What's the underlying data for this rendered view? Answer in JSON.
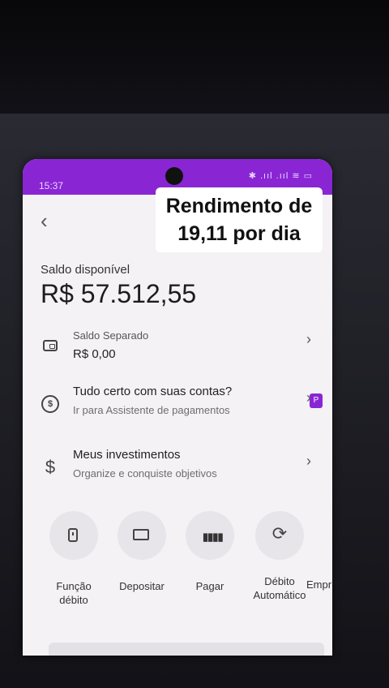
{
  "status_bar": {
    "time": "15:37",
    "icons": "✱ .ııl .ııl ≋ ▭"
  },
  "overlay_caption": {
    "line1": "Rendimento de",
    "line2": "19,11 por dia"
  },
  "balance": {
    "label": "Saldo disponível",
    "value": "R$ 57.512,55"
  },
  "rows": [
    {
      "title": "Saldo Separado",
      "subtitle": "R$ 0,00",
      "icon": "wallet-icon"
    },
    {
      "title": "Tudo certo com suas contas?",
      "subtitle": "Ir para Assistente de pagamentos",
      "icon": "money-refresh-icon"
    },
    {
      "title": "Meus investimentos",
      "subtitle": "Organize e conquiste objetivos",
      "icon": "dollar-icon"
    }
  ],
  "actions": [
    {
      "label_line1": "Função",
      "label_line2": "débito",
      "icon": "card-icon"
    },
    {
      "label_line1": "Depositar",
      "label_line2": "",
      "icon": "deposit-icon"
    },
    {
      "label_line1": "Pagar",
      "label_line2": "",
      "icon": "barcode-icon"
    },
    {
      "label_line1": "Débito",
      "label_line2": "Automático",
      "icon": "refresh-icon"
    },
    {
      "label_line1": "Empr",
      "label_line2": "",
      "icon": "loan-icon"
    }
  ],
  "badge": "P",
  "colors": {
    "brand": "#8a25d4",
    "background": "#f4f2f5"
  }
}
